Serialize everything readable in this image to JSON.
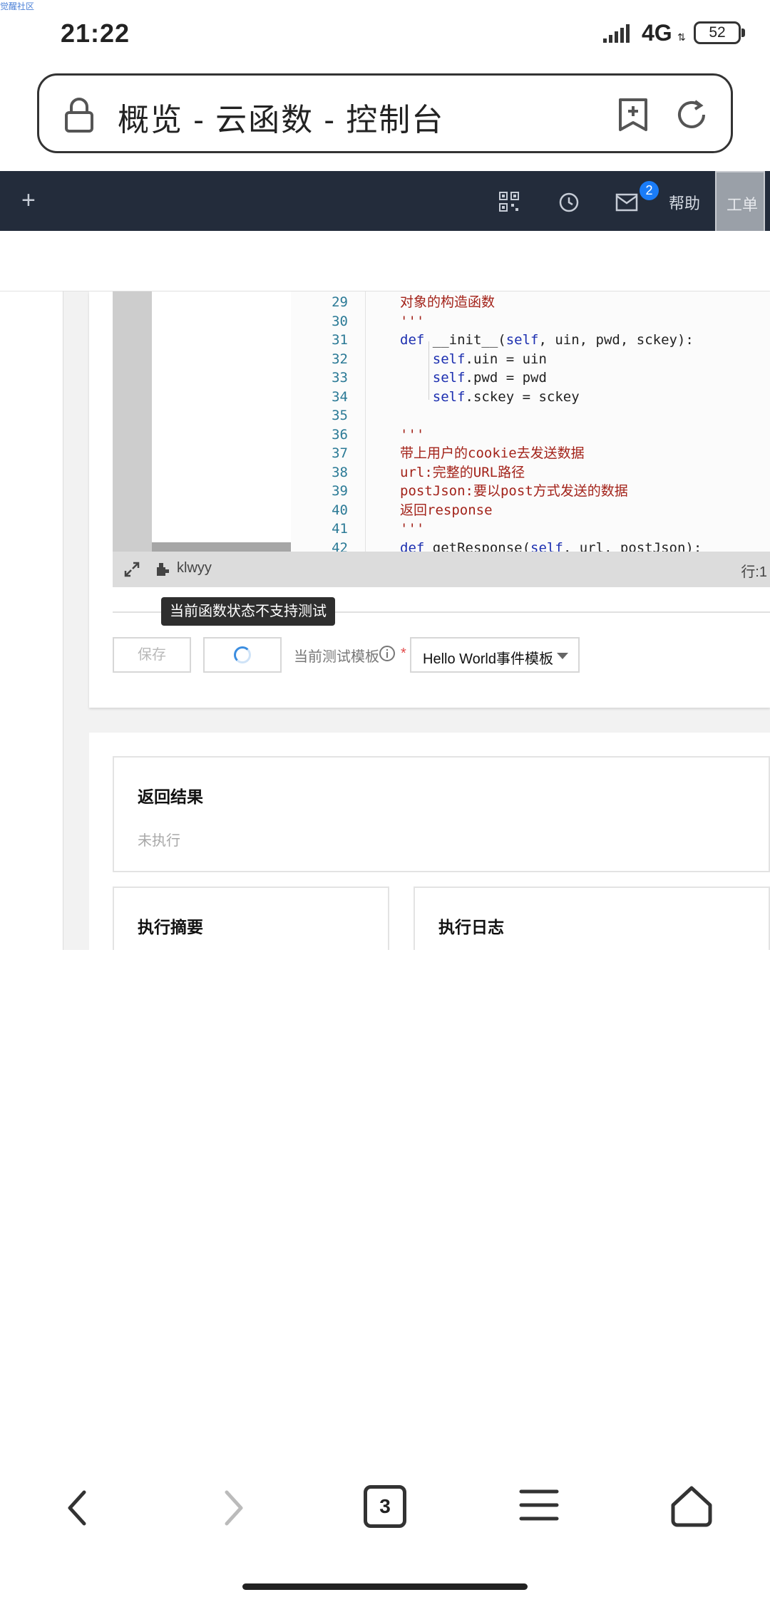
{
  "watermark": "觉醒社区",
  "status_bar": {
    "time": "21:22",
    "network": "4G",
    "battery": "52"
  },
  "address_bar": {
    "title": "概览 - 云函数 - 控制台"
  },
  "console_header": {
    "mail_badge": "2",
    "help": "帮助",
    "ticket": "工单"
  },
  "editor": {
    "line_numbers": [
      "29",
      "30",
      "31",
      "32",
      "33",
      "34",
      "35",
      "36",
      "37",
      "38",
      "39",
      "40",
      "41",
      "42"
    ],
    "repo_name": "klwyy",
    "cursor": "行:1"
  },
  "toolbar": {
    "tooltip": "当前函数状态不支持测试",
    "save_label": "保存",
    "template_label": "当前测试模板",
    "required": "*",
    "template_value": "Hello World事件模板"
  },
  "results": {
    "return_title": "返回结果",
    "return_status": "未执行",
    "summary_title": "执行摘要",
    "log_title": "执行日志"
  },
  "bottom_nav": {
    "tab_count": "3"
  },
  "colors": {
    "header_bg": "#232c3b",
    "badge": "#1a7cf7",
    "code_string": "#a3231a",
    "code_keyword": "#1c2fb0",
    "line_number": "#2b7a96"
  }
}
